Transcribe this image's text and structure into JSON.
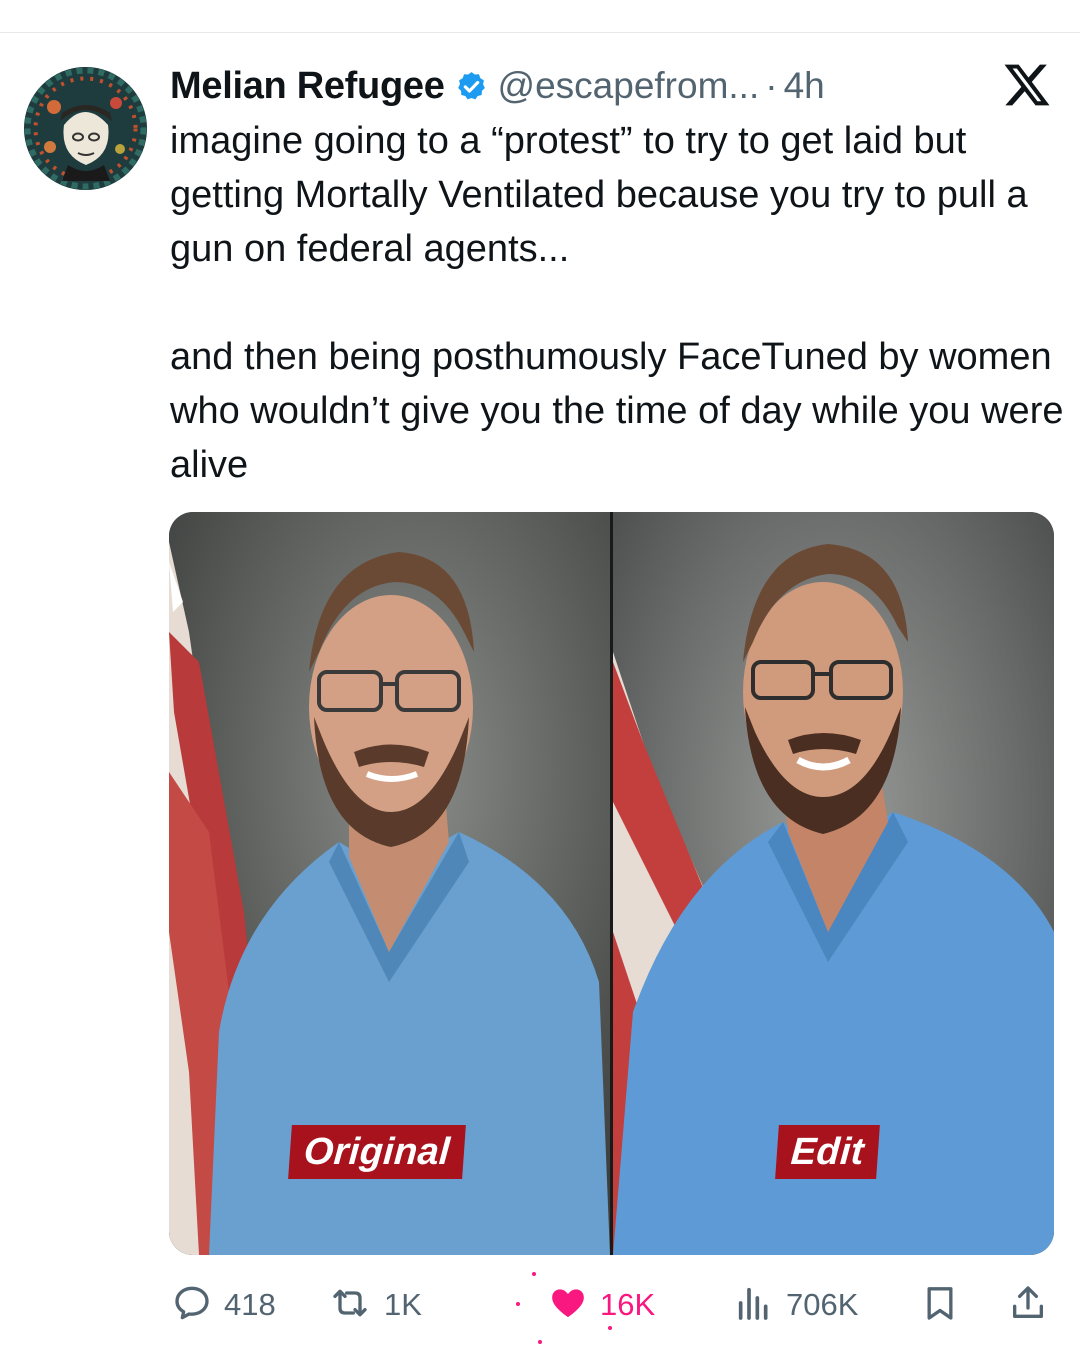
{
  "tweet": {
    "author": {
      "display_name": "Melian Refugee",
      "handle": "@escapefrom...",
      "verified": true,
      "avatar": "avatar-image"
    },
    "separator": "·",
    "timestamp": "4h",
    "paragraphs": [
      "imagine going to a “protest” to try to get laid but getting Mortally Ventilated because you try to pull a gun on federal agents...",
      "and then being posthumously FaceTuned by women who wouldn’t give you the time of day while you were alive"
    ],
    "media": {
      "panels": [
        {
          "label": "Original"
        },
        {
          "label": "Edit"
        }
      ]
    },
    "actions": {
      "replies": "418",
      "reposts": "1K",
      "likes": "16K",
      "views": "706K",
      "liked": true
    }
  },
  "colors": {
    "text_primary": "#0f1419",
    "text_secondary": "#536471",
    "verified_blue": "#1d9bf0",
    "like_pink": "#f91880",
    "label_red": "#a8121c"
  },
  "icons": [
    "x-logo-icon",
    "verified-badge-icon",
    "reply-icon",
    "repost-icon",
    "heart-icon",
    "views-icon",
    "bookmark-icon",
    "share-icon"
  ]
}
